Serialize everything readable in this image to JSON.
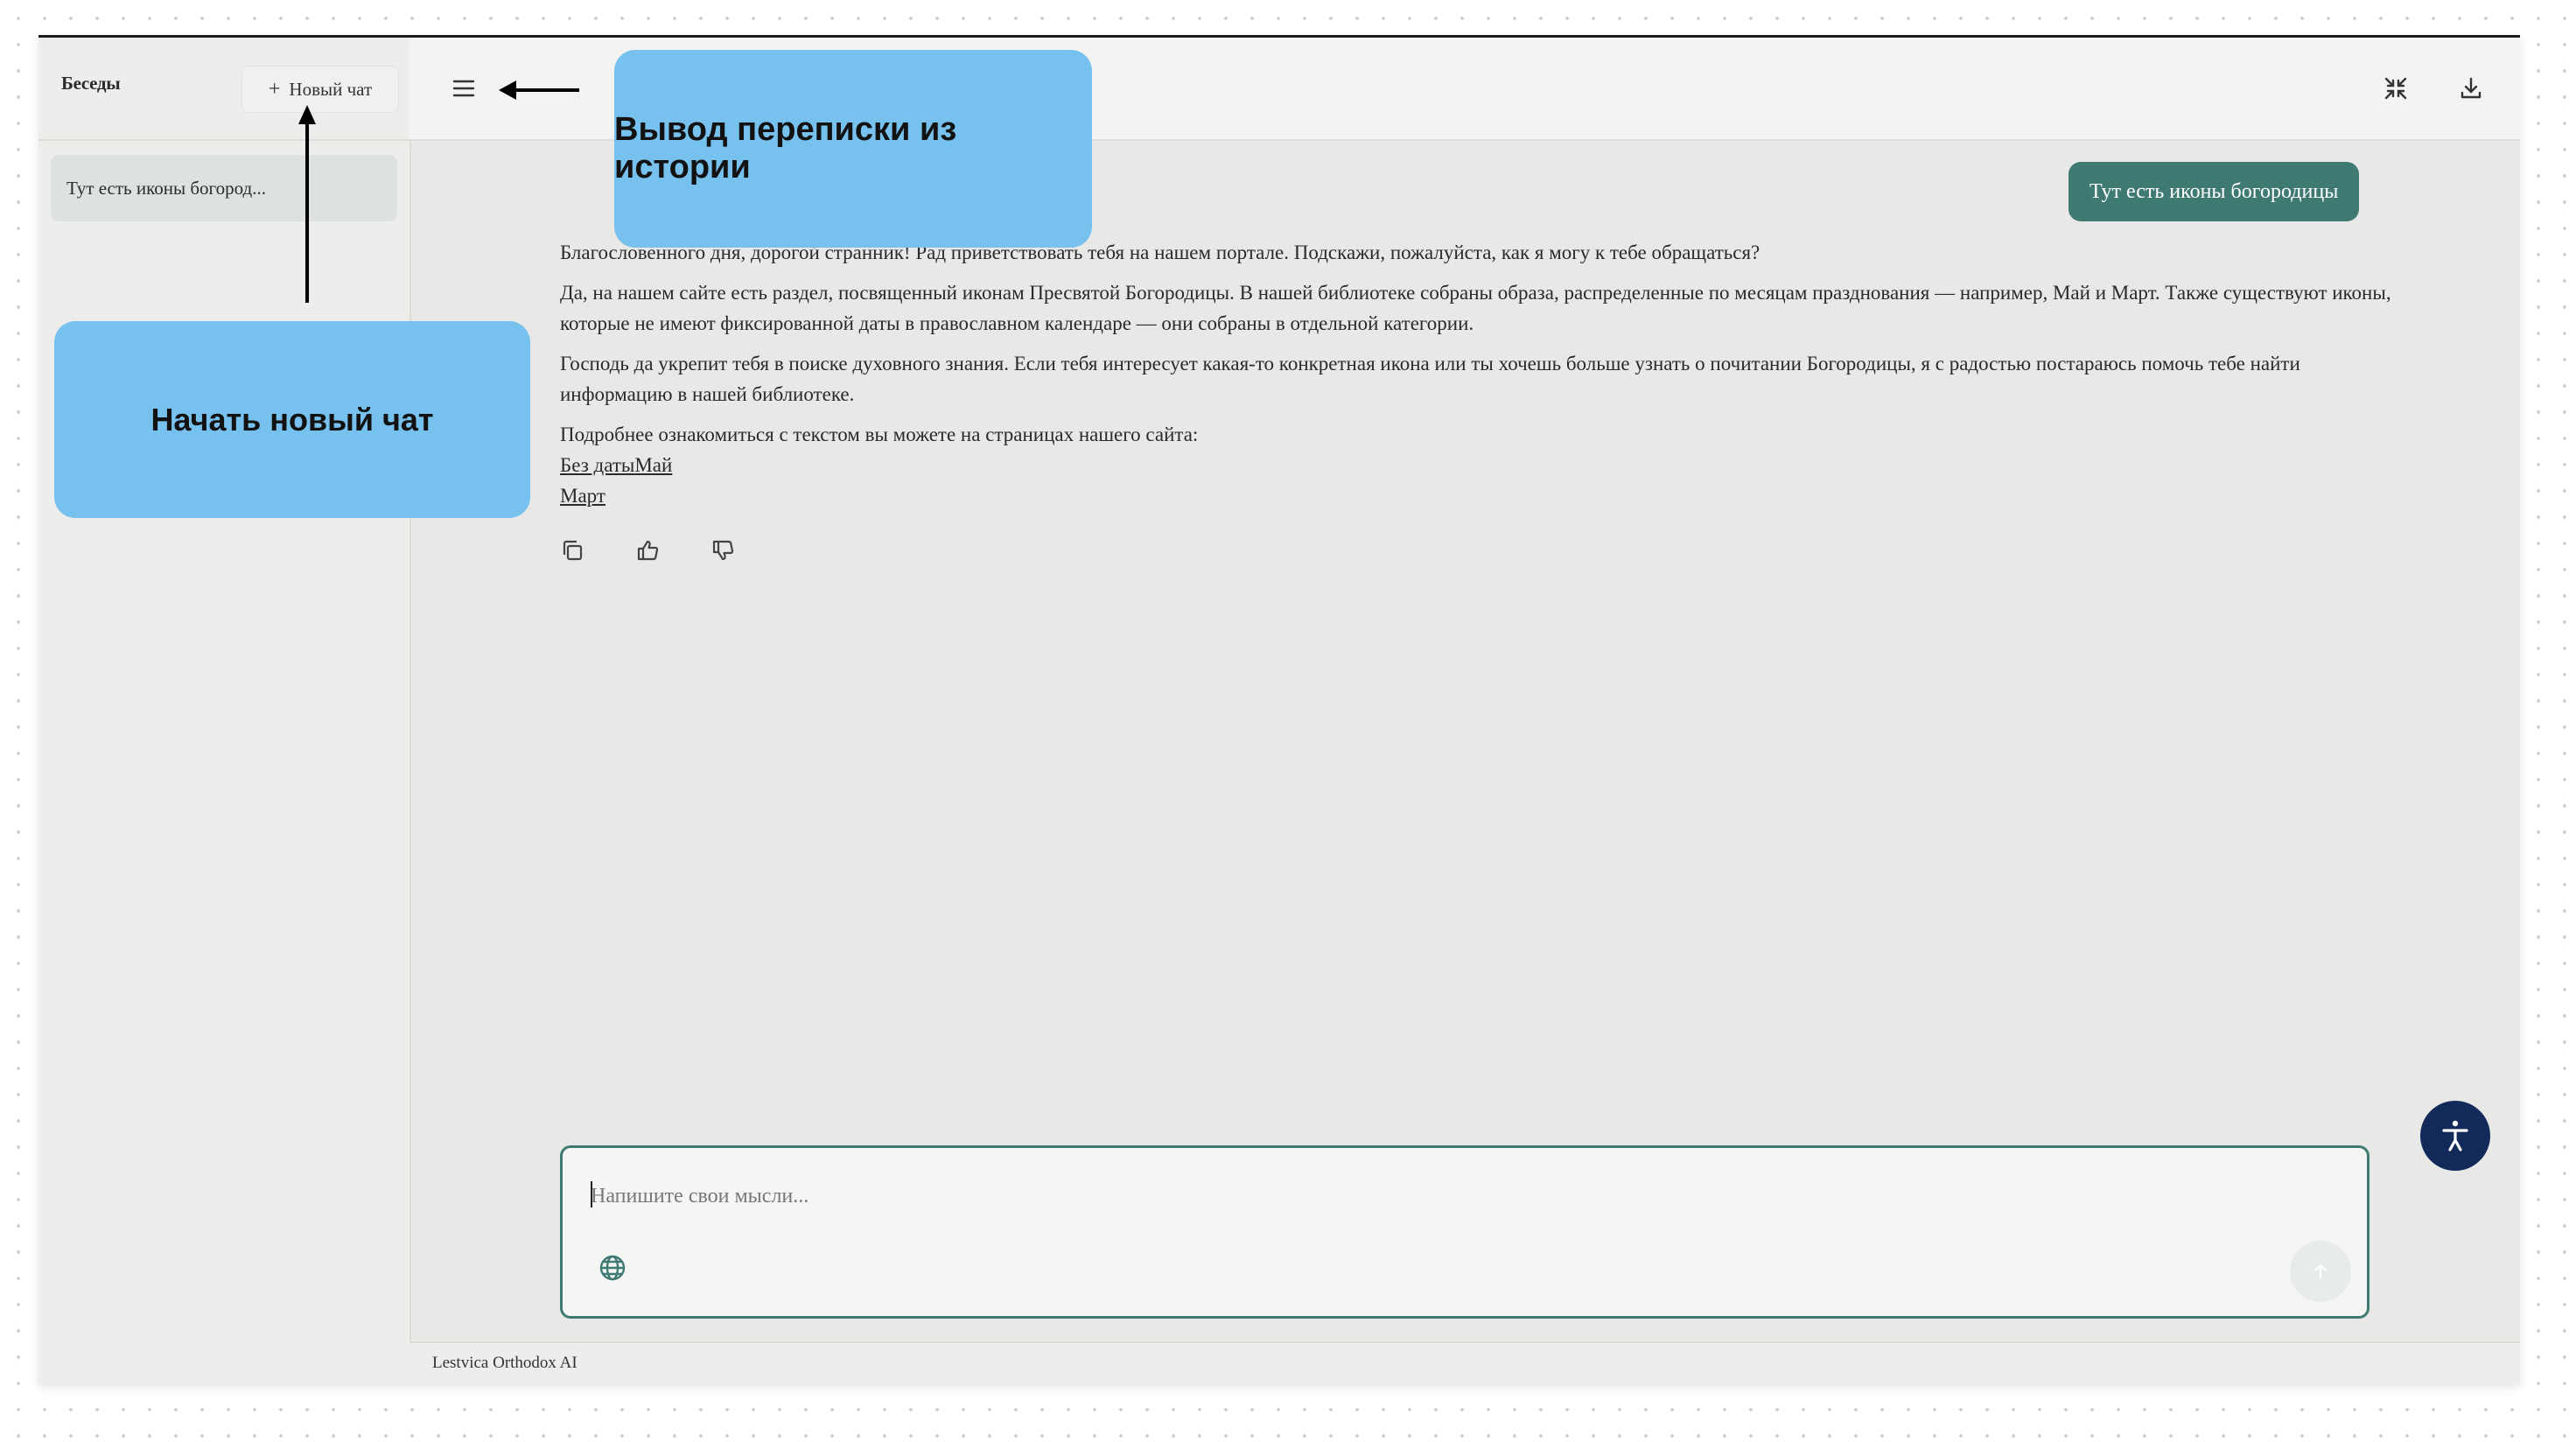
{
  "sidebar": {
    "title": "Беседы",
    "new_chat_label": "Новый чат",
    "history": [
      {
        "label": "Тут есть иконы богород..."
      }
    ]
  },
  "chat": {
    "user_message": "Тут есть иконы богородицы",
    "assistant_paragraphs": [
      "Благословенного дня, дорогой странник! Рад приветствовать тебя на нашем портале. Подскажи, пожалуйста, как я могу к тебе обращаться?",
      "Да, на нашем сайте есть раздел, посвященный иконам Пресвятой Богородицы. В нашей библиотеке собраны образа, распределенные по месяцам празднования — например, Май и Март. Также существуют иконы, которые не имеют фиксированной даты в православном календаре — они собраны в отдельной категории.",
      "Господь да укрепит тебя в поиске духовного знания. Если тебя интересует какая-то конкретная икона или ты хочешь больше узнать о почитании Богородицы, я с радостью постараюсь помочь тебе найти информацию в нашей библиотеке.",
      "Подробнее ознакомиться с текстом вы можете на страницах нашего сайта:"
    ],
    "links": [
      "Без даты",
      "Май",
      "Март"
    ]
  },
  "composer": {
    "placeholder": "Напишите свои мысли..."
  },
  "footer": {
    "text": "Lestvica Orthodox AI"
  },
  "annotations": {
    "history_output": "Вывод переписки из истории",
    "new_chat": "Начать новый чат"
  },
  "icons": {
    "menu": "menu-icon",
    "collapse": "collapse-icon",
    "download": "download-icon",
    "copy": "copy-icon",
    "like": "thumbs-up-icon",
    "dislike": "thumbs-down-icon",
    "globe": "globe-icon",
    "send": "arrow-up-icon",
    "accessibility": "accessibility-icon"
  },
  "colors": {
    "accent": "#3f7a72",
    "callout": "#77c1ee",
    "accessibility_button": "#13295a"
  }
}
